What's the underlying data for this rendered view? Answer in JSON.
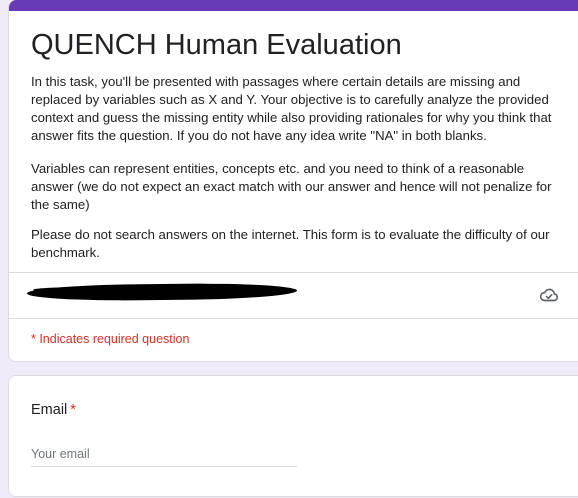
{
  "form": {
    "title": "QUENCH Human Evaluation",
    "description": [
      "In this task, you'll be presented with passages where certain details are missing and replaced by variables such as X and Y. Your objective is to carefully analyze the provided context and guess the missing entity while also providing rationales for why you think that answer fits the question. If you do not have any idea write \"NA\" in both blanks.",
      "Variables can represent entities, concepts etc. and you need to think of a reasonable answer (we do not expect an exact match with our answer and hence will not penalize for the same)",
      "Please do not search answers on the internet. This form is to evaluate the difficulty of our benchmark."
    ],
    "account_icon": "cloud-check-icon",
    "required_note": "* Indicates required question"
  },
  "questions": [
    {
      "title": "Email",
      "required_marker": "*",
      "placeholder": "Your email",
      "value": ""
    }
  ],
  "colors": {
    "accent": "#673ab7",
    "background": "#f0ebf8",
    "required": "#d93025",
    "border": "#dadce0"
  }
}
